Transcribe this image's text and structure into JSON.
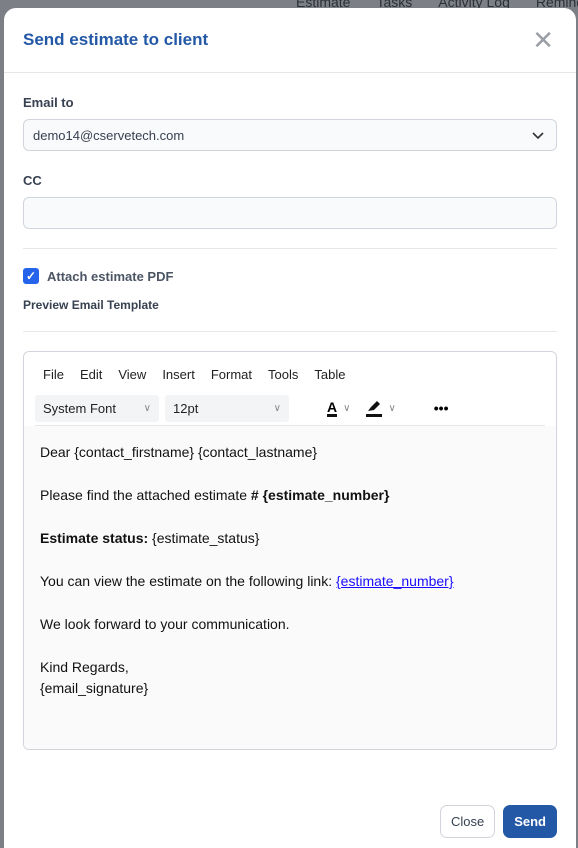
{
  "background_tabs": [
    "Estimate",
    "Tasks",
    "Activity Log",
    "Reminders"
  ],
  "modal": {
    "title": "Send estimate to client"
  },
  "form": {
    "email_label": "Email to",
    "email_value": "demo14@cservetech.com",
    "cc_label": "CC",
    "cc_value": "",
    "attach_label": "Attach estimate PDF",
    "attach_checked": true,
    "preview_label": "Preview Email Template"
  },
  "editor": {
    "menu": [
      "File",
      "Edit",
      "View",
      "Insert",
      "Format",
      "Tools",
      "Table"
    ],
    "font": "System Font",
    "size": "12pt",
    "content": {
      "greeting": "Dear {contact_firstname} {contact_lastname}",
      "line1": "Please find the attached estimate ",
      "line1_bold": "# {estimate_number}",
      "status_label": "Estimate status:",
      "status_value": " {estimate_status}",
      "link_text": "You can view the estimate on the following link: ",
      "link": "{estimate_number}",
      "forward": "We look forward to your communication.",
      "regards": "Kind Regards,",
      "signature": "{email_signature}"
    }
  },
  "footer": {
    "close": "Close",
    "send": "Send"
  },
  "colors": {
    "accent": "#2358a6",
    "checkbox": "#2563eb"
  }
}
